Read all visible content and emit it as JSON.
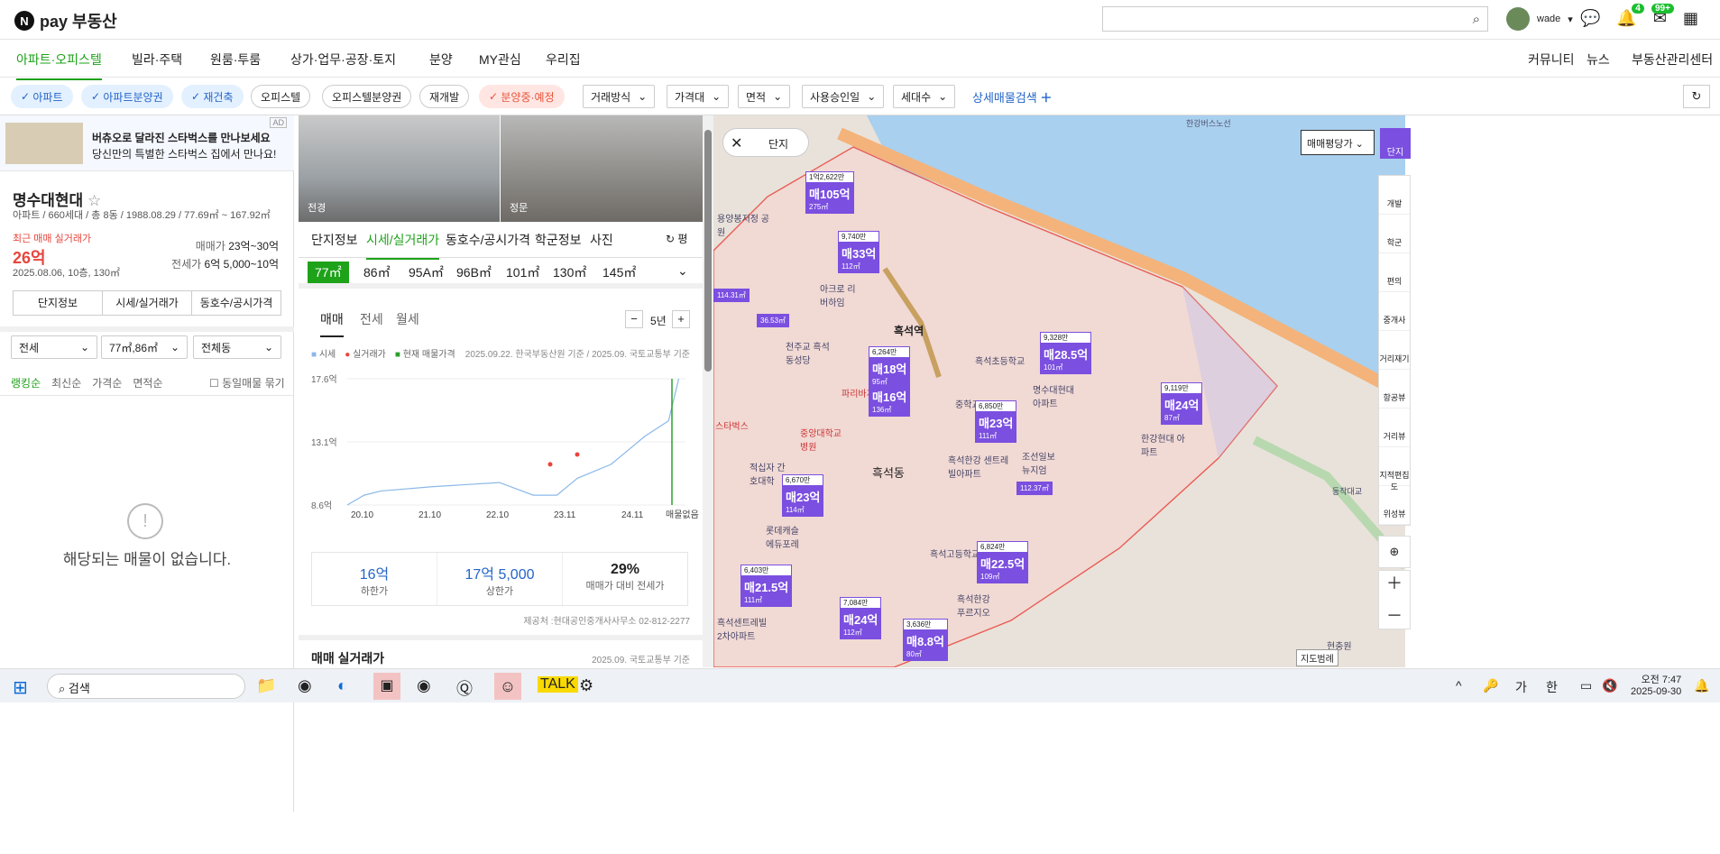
{
  "header": {
    "logo_mark": "N",
    "logo_text": "pay 부동산",
    "user": "wade",
    "bell_badge": "4",
    "mail_badge": "99+"
  },
  "nav": {
    "items": [
      "아파트·오피스텔",
      "빌라·주택",
      "원룸·투룸",
      "상가·업무·공장·토지",
      "분양",
      "MY관심",
      "우리집"
    ],
    "right": [
      "커뮤니티",
      "뉴스",
      "부동산관리센터"
    ]
  },
  "filters": {
    "chips": [
      "아파트",
      "아파트분양권",
      "재건축",
      "오피스텔",
      "오피스텔분양권",
      "재개발",
      "분양중·예정"
    ],
    "dropdowns": [
      "거래방식",
      "가격대",
      "면적",
      "사용승인일",
      "세대수"
    ],
    "detail": "상세매물검색"
  },
  "ad": {
    "tag": "AD",
    "title": "버츄오로 달라진 스타벅스를 만나보세요",
    "sub": "당신만의 특별한 스타벅스 집에서 만나요!"
  },
  "complex": {
    "name": "명수대현대",
    "info": "아파트 / 660세대 / 총 8동 / 1988.08.29 / 77.69㎡ ~ 167.92㎡",
    "recent_label": "최근 매매 실거래가",
    "recent_price": "26억",
    "recent_date": "2025.08.06, 10층, 130㎡",
    "sale_label": "매매가",
    "sale_range": "23억~30억",
    "jeonse_label": "전세가",
    "jeonse_range": "6억 5,000~10억",
    "btns": [
      "단지정보",
      "시세/실거래가",
      "동호수/공시가격"
    ]
  },
  "listfilter": {
    "sel1": "전세",
    "sel2": "77㎡,86㎡",
    "sel3": "전체동",
    "sorts": [
      "랭킹순",
      "최신순",
      "가격순",
      "면적순"
    ],
    "group": "동일매물 묶기",
    "empty": "해당되는 매물이 없습니다."
  },
  "photos": {
    "p1": "전경",
    "p2": "정문"
  },
  "tabs": [
    "단지정보",
    "시세/실거래가",
    "동호수/공시가격",
    "학군정보",
    "사진"
  ],
  "refresh": "평",
  "sizes": [
    "77㎡",
    "86㎡",
    "95A㎡",
    "96B㎡",
    "101㎡",
    "130㎡",
    "145㎡"
  ],
  "deal": {
    "tabs": [
      "매매",
      "전세",
      "월세"
    ],
    "period": "5년",
    "legend": [
      "시세",
      "실거래가",
      "현재 매물가격"
    ],
    "source": "2025.09.22. 한국부동산원 기준 / 2025.09. 국토교통부 기준",
    "no_listing": "매물없음"
  },
  "chart_data": {
    "type": "line",
    "title": "",
    "x": [
      "20.10",
      "21.10",
      "22.10",
      "23.11",
      "24.11"
    ],
    "y_ticks": [
      "17.6억",
      "13.1억",
      "8.6억"
    ],
    "ylim": [
      8.6,
      17.6
    ],
    "series": [
      {
        "name": "시세",
        "color": "#8bb8e8",
        "points": [
          [
            0,
            8.6
          ],
          [
            0.05,
            9.3
          ],
          [
            0.1,
            9.6
          ],
          [
            0.25,
            9.9
          ],
          [
            0.45,
            10.2
          ],
          [
            0.55,
            9.3
          ],
          [
            0.62,
            9.3
          ],
          [
            0.68,
            10.5
          ],
          [
            0.78,
            11.5
          ],
          [
            0.88,
            13.5
          ],
          [
            0.95,
            14.6
          ],
          [
            0.98,
            17.6
          ]
        ]
      },
      {
        "name": "실거래가",
        "color": "#e8453c",
        "points": [
          [
            0.6,
            11.5
          ],
          [
            0.68,
            12.2
          ]
        ]
      },
      {
        "name": "현재 매물가격",
        "color": "#2ca02c",
        "points": [
          [
            0.96,
            8.6
          ],
          [
            0.96,
            17.6
          ]
        ]
      }
    ]
  },
  "stats": [
    {
      "v": "16억",
      "l": "하한가"
    },
    {
      "v": "17억 5,000",
      "l": "상한가"
    },
    {
      "v": "29%",
      "l": "매매가 대비 전세가"
    }
  ],
  "provider": "제공처 :현대공인중개사사무소 02-812-2277",
  "sect": {
    "title": "매매 실거래가",
    "date": "2025.09. 국토교통부 기준"
  },
  "map": {
    "danji_label": "단지",
    "selector": "매매평당가",
    "danji_btn": "단지",
    "labels": {
      "area": "흑석동",
      "station": "흑석역",
      "river_road": "한강버스노선",
      "m1": "흑석초등학교",
      "m2": "명수대현대 아파트",
      "m3": "한강현대 아파트",
      "m4": "중앙대학교 병원",
      "m5": "흑석고등학교",
      "m6": "조선일보 뉴지엄",
      "m7": "천주교 흑석동성당",
      "m8": "아크로 리버하임",
      "m9": "파리바게뜨",
      "m10": "스타벅스",
      "m11": "동작대교",
      "m12": "현충원",
      "m13": "적십자 간호대학",
      "m14": "롯데캐슬 에듀포레",
      "m15": "흑석한강 센트레빌아파트",
      "m16": "흑석한강 푸르지오",
      "m17": "흑석센트레빌 2차아파트",
      "m18": "용양봉저정 공원",
      "m19": "중학교"
    },
    "scale": "지도범례",
    "markers": [
      {
        "top": "1억2,622만",
        "main": "매105억",
        "sub": "275㎡"
      },
      {
        "top": "9,740만",
        "main": "매33억",
        "sub": "112㎡"
      },
      {
        "top": "6,264만",
        "main": "매18억",
        "sub": "95㎡"
      },
      {
        "top": "",
        "main": "매16억",
        "sub": "136㎡"
      },
      {
        "top": "9,328만",
        "main": "매28.5억",
        "sub": "101㎡"
      },
      {
        "top": "6,850만",
        "main": "매23억",
        "sub": "111㎡"
      },
      {
        "top": "9,119만",
        "main": "매24억",
        "sub": "87㎡"
      },
      {
        "top": "6,670만",
        "main": "매23억",
        "sub": "114㎡"
      },
      {
        "top": "6,824만",
        "main": "매22.5억",
        "sub": "109㎡"
      },
      {
        "top": "6,403만",
        "main": "매21.5억",
        "sub": "111㎡"
      },
      {
        "top": "7,084만",
        "main": "매24억",
        "sub": "112㎡"
      },
      {
        "top": "3,636만",
        "main": "매8.8억",
        "sub": "80㎡"
      },
      {
        "top": "",
        "main": "",
        "sub": "114.31㎡"
      },
      {
        "top": "",
        "main": "",
        "sub": "36.53㎡"
      },
      {
        "top": "",
        "main": "",
        "sub": "112.37㎡"
      }
    ],
    "tools": [
      "개발",
      "학군",
      "편의",
      "중개사",
      "거리재기",
      "항공뷰",
      "거리뷰",
      "지적편집도",
      "위성뷰"
    ]
  },
  "taskbar": {
    "search": "검색",
    "time": "오전 7:47",
    "date": "2025-09-30",
    "ime": [
      "가",
      "한"
    ]
  }
}
